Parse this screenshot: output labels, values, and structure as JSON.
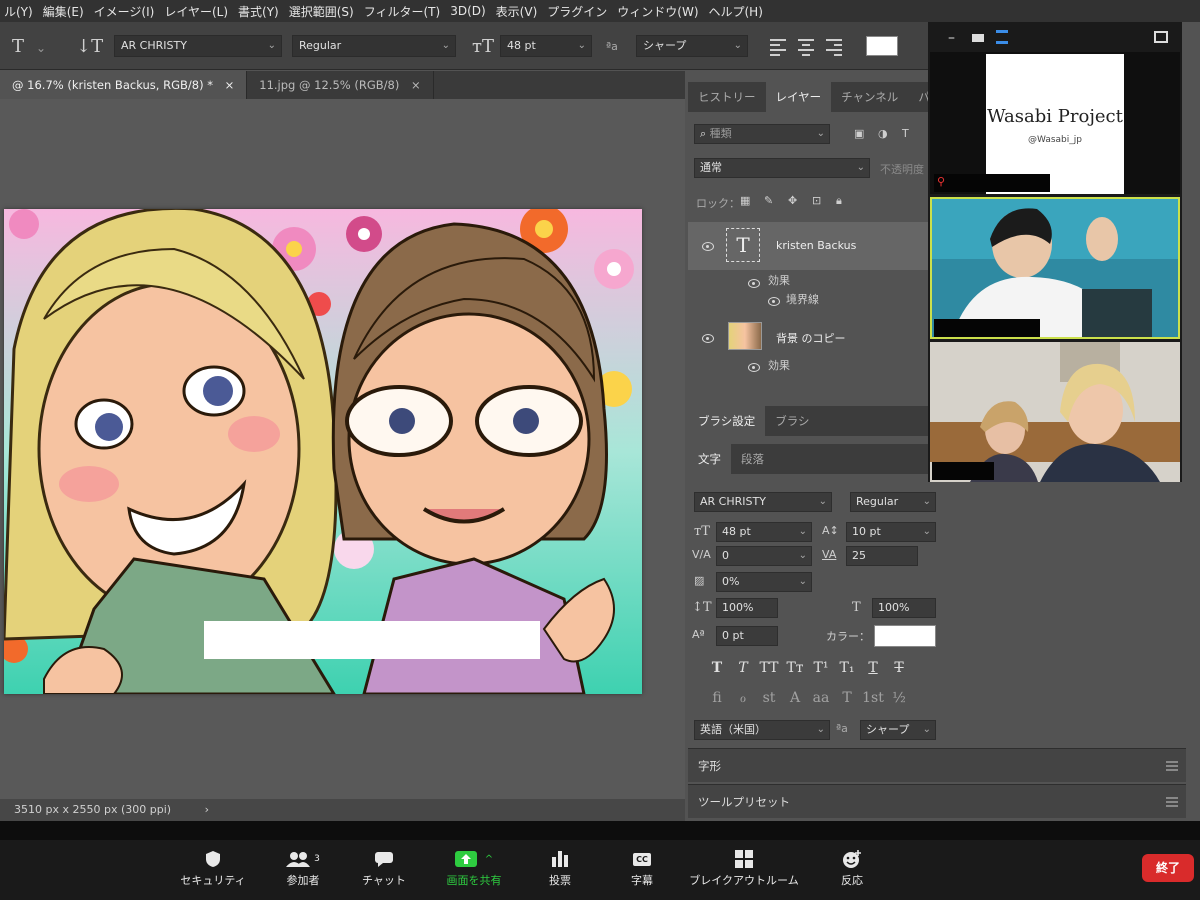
{
  "menu": [
    "ル(Y)",
    "編集(E)",
    "イメージ(I)",
    "レイヤー(L)",
    "書式(Y)",
    "選択範囲(S)",
    "フィルター(T)",
    "3D(D)",
    "表示(V)",
    "プラグイン",
    "ウィンドウ(W)",
    "ヘルプ(H)"
  ],
  "options": {
    "font_family": "AR CHRISTY",
    "font_style": "Regular",
    "font_size": "48 pt",
    "aa_icon": "ªa",
    "anti_alias": "シャープ",
    "swatch_color": "#ffffff"
  },
  "doc_tabs": [
    {
      "label": "@ 16.7% (kristen    Backus, RGB/8) *",
      "close": "×"
    },
    {
      "label": "11.jpg @ 12.5% (RGB/8)",
      "close": "×"
    }
  ],
  "status": {
    "dimensions": "3510 px x 2550 px (300 ppi)",
    "arrow": "›"
  },
  "layers_panel": {
    "tabs": [
      "ヒストリー",
      "レイヤー",
      "チャンネル",
      "パス"
    ],
    "search_placeholder": "種類",
    "blend_mode": "通常",
    "opacity_label": "不透明度",
    "lock_label": "ロック：",
    "layers": [
      {
        "name": "kristen    Backus",
        "thumb": "T",
        "effects_label": "効果",
        "effect": "境界線"
      },
      {
        "name": "背景 のコピー",
        "effects_label": "効果"
      }
    ]
  },
  "char_panel": {
    "top_tabs": [
      "ブラシ設定",
      "ブラシ"
    ],
    "tabs": [
      "文字",
      "段落"
    ],
    "font_family": "AR CHRISTY",
    "font_style": "Regular",
    "size": "48 pt",
    "leading": "10 pt",
    "kerning_label": "V/A",
    "kerning": "0",
    "tracking_label": "VA",
    "tracking": "25",
    "scale_pct": "0%",
    "vscale": "100%",
    "hscale": "100%",
    "baseline": "0 pt",
    "color_label": "カラー：",
    "color": "#ffffff",
    "style_glyphs": [
      "T",
      "T",
      "TT",
      "Tт",
      "T¹",
      "T₁",
      "T",
      "T"
    ],
    "opentype_glyphs": [
      "ﬁ",
      "ℴ",
      "st",
      "A",
      "aa",
      "T",
      "1st",
      "½"
    ],
    "language": "英語（米国）",
    "aa_icon": "ªa",
    "anti_alias": "シャープ"
  },
  "collapsed_panels": [
    "字形",
    "ツールプリセット"
  ],
  "zoom_overlay": {
    "title_card": "Wasabi Project",
    "handle": "@Wasabi_jp"
  },
  "zoom_bar": {
    "buttons": [
      {
        "label": "セキュリティ",
        "icon": "shield-icon"
      },
      {
        "label": "参加者",
        "icon": "participants-icon",
        "count": "3"
      },
      {
        "label": "チャット",
        "icon": "chat-icon"
      },
      {
        "label": "画面を共有",
        "icon": "share-screen-icon",
        "caret": "^"
      },
      {
        "label": "投票",
        "icon": "poll-icon"
      },
      {
        "label": "字幕",
        "icon": "cc-icon",
        "cc": "CC"
      },
      {
        "label": "ブレイクアウトルーム",
        "icon": "breakout-icon"
      },
      {
        "label": "反応",
        "icon": "reaction-icon"
      }
    ],
    "end_label": "終了",
    "accent_green": "#2ecc40",
    "end_color": "#d92b2b"
  }
}
